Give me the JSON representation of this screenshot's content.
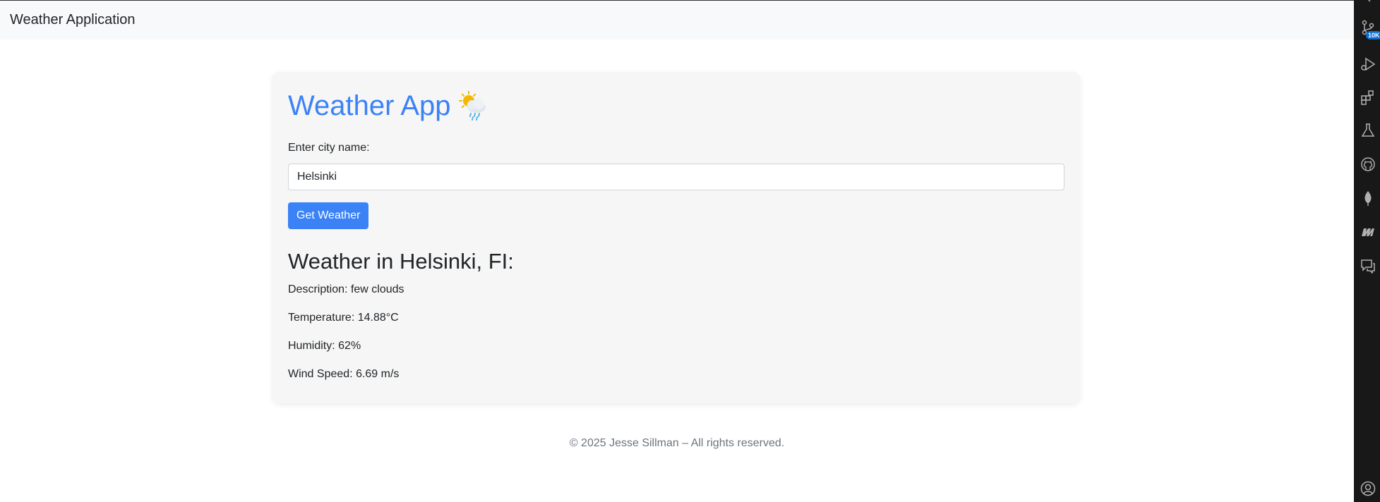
{
  "navbar": {
    "brand": "Weather Application"
  },
  "app": {
    "title": "Weather App",
    "title_icon": "sun-behind-rain-cloud-icon",
    "accent_color": "#3b82f6",
    "city_label": "Enter city name:",
    "city_value": "Helsinki",
    "submit_label": "Get Weather"
  },
  "result": {
    "heading": "Weather in Helsinki, FI:",
    "description_label": "Description:",
    "description_value": "few clouds",
    "temperature_label": "Temperature:",
    "temperature_value": "14.88°C",
    "humidity_label": "Humidity:",
    "humidity_value": "62%",
    "wind_label": "Wind Speed:",
    "wind_value": "6.69 m/s"
  },
  "footer": {
    "text": "© 2025 Jesse Sillman – All rights reserved."
  },
  "activity_bar": {
    "source_control_badge": "10K",
    "icons": [
      "chevron-icon",
      "source-control-icon",
      "run-debug-icon",
      "extensions-icon",
      "testing-flask-icon",
      "github-icon",
      "mongodb-leaf-icon",
      "extension-m-icon",
      "chat-icon",
      "account-icon"
    ]
  }
}
